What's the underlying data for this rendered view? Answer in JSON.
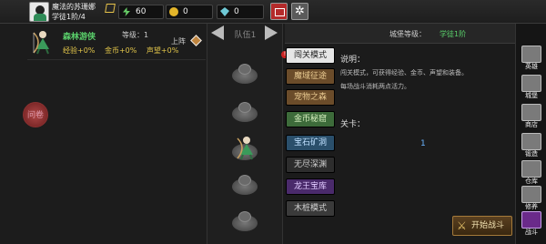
{
  "player": {
    "name": "魔法的苏珊娜",
    "level_text": "学徒1阶/4"
  },
  "resources": {
    "energy": "60",
    "gold": "0",
    "gems": "0"
  },
  "hero": {
    "name": "森林游侠",
    "level_label": "等级：1",
    "stats": [
      "经验+0%",
      "金币+0%",
      "声望+0%"
    ],
    "deploy_label": "上阵"
  },
  "side_left_button": "问卷",
  "team": {
    "label": "队伍1"
  },
  "castle": {
    "label": "城堡等级：",
    "value": "学徒1阶"
  },
  "modes": [
    {
      "label": "闯关模式",
      "bg": "#e6e6e6",
      "fg": "#222"
    },
    {
      "label": "魔域征途",
      "bg": "#6b4c2a",
      "fg": "#e8c990"
    },
    {
      "label": "宠物之森",
      "bg": "#6b4c2a",
      "fg": "#e8c990"
    },
    {
      "label": "金币秘窟",
      "bg": "#3d6b3a",
      "fg": "#d8f0c0"
    },
    {
      "label": "宝石矿洞",
      "bg": "#2a4f6b",
      "fg": "#bfe0ff"
    },
    {
      "label": "无尽深渊",
      "bg": "#2d2d2d",
      "fg": "#cfcfcf"
    },
    {
      "label": "龙王宝库",
      "bg": "#4a2a6b",
      "fg": "#e0c8ff"
    },
    {
      "label": "木桩模式",
      "bg": "#3a3a3a",
      "fg": "#cfcfcf"
    }
  ],
  "description": {
    "title": "说明：",
    "lines": [
      "闯关模式，可获得经验、金币、声望和装备。",
      "每场战斗消耗两点活力。"
    ]
  },
  "level": {
    "title": "关卡：",
    "value": "1"
  },
  "start_button": "开始战斗",
  "sidebar": [
    "英雄",
    "城堡",
    "商店",
    "锻造",
    "仓库",
    "修养",
    "战斗"
  ]
}
